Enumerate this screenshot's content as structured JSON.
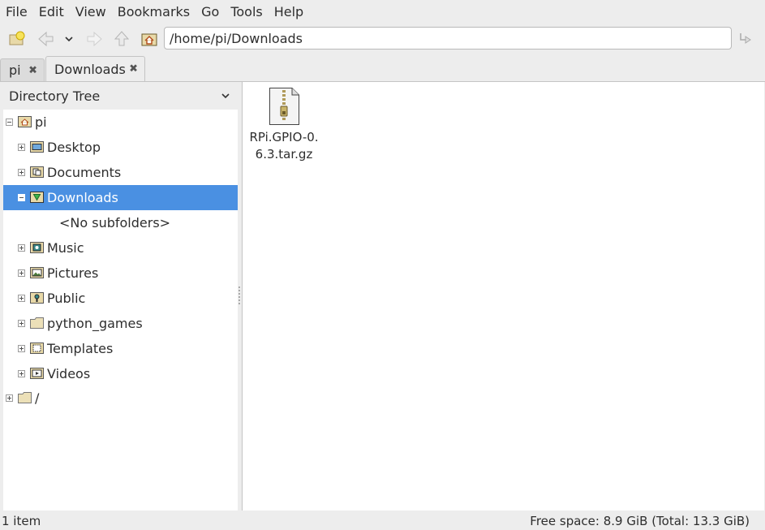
{
  "menubar": {
    "items": [
      "File",
      "Edit",
      "View",
      "Bookmarks",
      "Go",
      "Tools",
      "Help"
    ]
  },
  "toolbar": {
    "location": "/home/pi/Downloads"
  },
  "tabs": [
    {
      "label": "pi",
      "active": false
    },
    {
      "label": "Downloads",
      "active": true
    }
  ],
  "side_pane": {
    "mode": "Directory Tree",
    "tree": [
      {
        "label": "pi",
        "icon": "home-folder-icon",
        "expander": "minus"
      },
      {
        "label": "Desktop",
        "icon": "desktop-folder-icon",
        "expander": "plus"
      },
      {
        "label": "Documents",
        "icon": "documents-folder-icon",
        "expander": "plus"
      },
      {
        "label": "Downloads",
        "icon": "downloads-folder-icon",
        "expander": "minus",
        "selected": true
      },
      {
        "label": "<No subfolders>",
        "icon": "",
        "expander": "none"
      },
      {
        "label": "Music",
        "icon": "music-folder-icon",
        "expander": "plus"
      },
      {
        "label": "Pictures",
        "icon": "pictures-folder-icon",
        "expander": "plus"
      },
      {
        "label": "Public",
        "icon": "public-folder-icon",
        "expander": "plus"
      },
      {
        "label": "python_games",
        "icon": "folder-icon",
        "expander": "plus"
      },
      {
        "label": "Templates",
        "icon": "templates-folder-icon",
        "expander": "plus"
      },
      {
        "label": "Videos",
        "icon": "videos-folder-icon",
        "expander": "plus"
      },
      {
        "label": "/",
        "icon": "folder-icon",
        "expander": "plus"
      }
    ]
  },
  "files": [
    {
      "name": "RPi.GPIO-0.6.3.tar.gz",
      "icon": "archive-icon"
    }
  ],
  "status": {
    "count": "1 item",
    "free_space": "Free space: 8.9 GiB (Total: 13.3 GiB)"
  },
  "colors": {
    "selection": "#4a90e2",
    "background": "#ededed"
  }
}
